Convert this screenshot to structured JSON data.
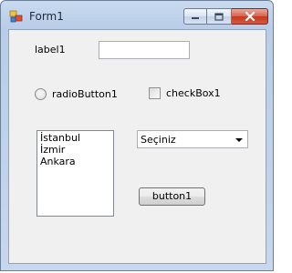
{
  "window": {
    "title": "Form1"
  },
  "caption_buttons": {
    "minimize": "minimize-icon",
    "maximize": "maximize-icon",
    "close": "close-icon"
  },
  "form": {
    "label1": "label1",
    "textbox1": {
      "value": ""
    },
    "radio": {
      "label": "radioButton1",
      "checked": false
    },
    "checkbox": {
      "label": "checkBox1",
      "checked": false
    },
    "listbox": {
      "items": [
        "İstanbul",
        "İzmir",
        "Ankara"
      ]
    },
    "combobox": {
      "selected": "Seçiniz"
    },
    "button1": "button1"
  },
  "colors": {
    "close_button": "#c4391f",
    "client_bg": "#f0f0f0",
    "frame": "#c9daf0"
  }
}
